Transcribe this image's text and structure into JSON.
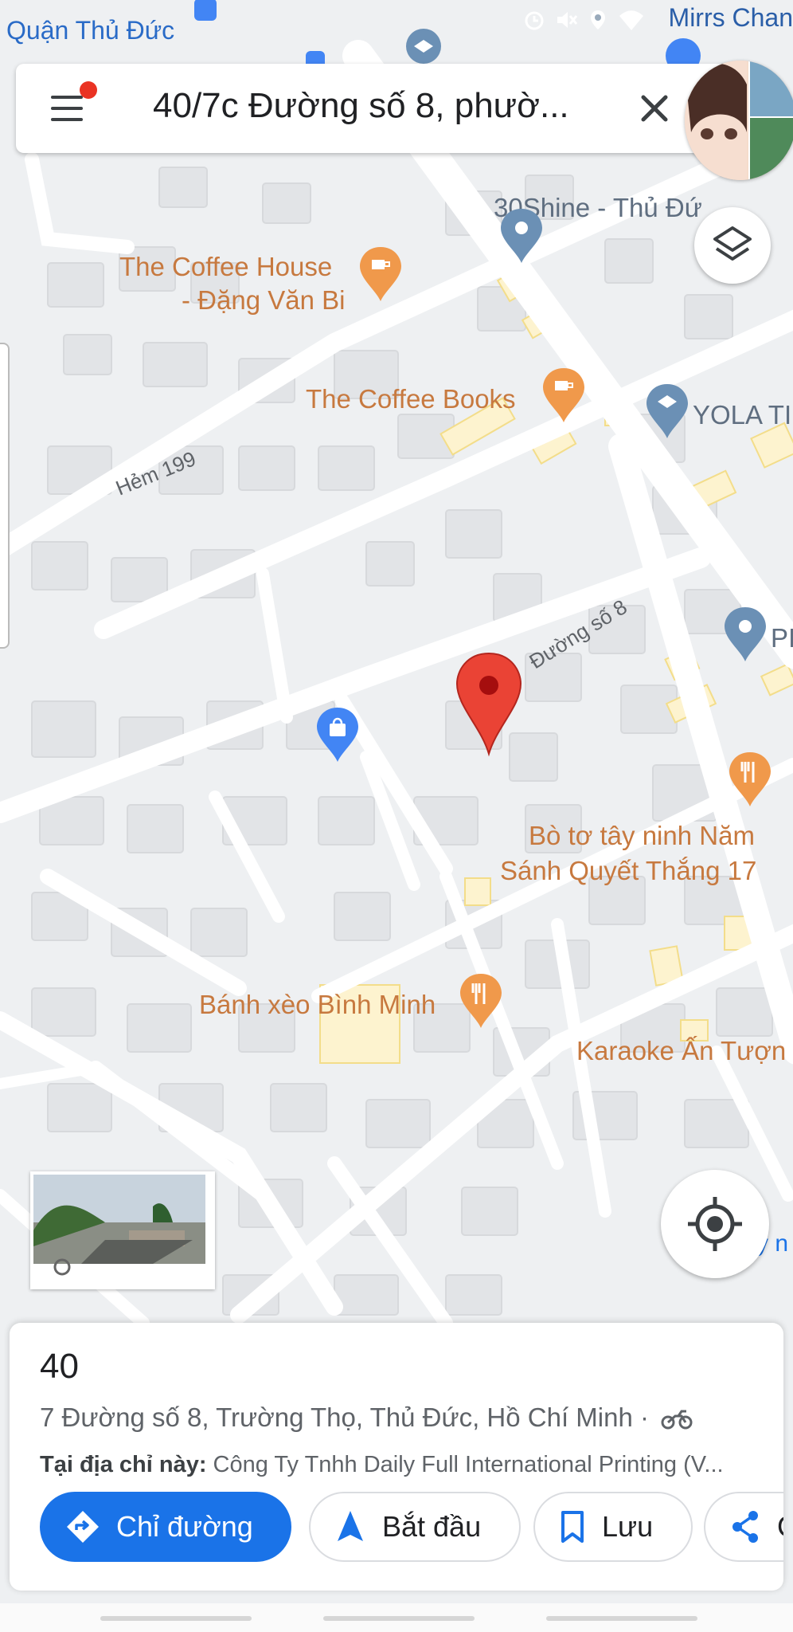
{
  "status_bar": {
    "background_text": "Quận Thủ Đức",
    "carrier": "Mirrs Chan"
  },
  "search": {
    "query": "40/7c Đường số 8, phườ..."
  },
  "map": {
    "road_labels": [
      "Hẻm 199",
      "Đường số 8"
    ],
    "pois": [
      {
        "name": "30Shine - Thủ Đứ",
        "icon": "generic-pin-icon",
        "color": "#6b90b5"
      },
      {
        "name": "The Coffee House - Đặng Văn Bi",
        "icon": "cafe-icon",
        "color": "#f0994b"
      },
      {
        "name": "The Coffee Books",
        "icon": "cafe-icon",
        "color": "#f0994b"
      },
      {
        "name": "YOLA TI",
        "icon": "school-icon",
        "color": "#6b90b5"
      },
      {
        "name": "PI",
        "icon": "generic-pin-icon",
        "color": "#6b90b5"
      },
      {
        "name": "Bò tơ tây ninh Năm Sánh Quyết Thắng 17",
        "icon": "restaurant-icon",
        "color": "#f0994b"
      },
      {
        "name": "Bánh xèo Bình Minh",
        "icon": "restaurant-icon",
        "color": "#f0994b"
      },
      {
        "name": "Karaoke Ấn Tượn",
        "icon": "none",
        "color": "#e07a3a"
      }
    ],
    "selected_pin_color": "#ea4335"
  },
  "place": {
    "title": "40",
    "address": "7 Đường số 8, Trường Thọ, Thủ Đức, Hồ Chí Minh · ",
    "at_label": "Tại địa chỉ này:",
    "at_value": " Công Ty Tnhh Daily Full International Printing (V..."
  },
  "actions": {
    "directions": "Chỉ đường",
    "start": "Bắt đầu",
    "save": "Lưu",
    "share": "C"
  },
  "colors": {
    "accent": "#1a73e8",
    "poi_orange": "#f0994b",
    "poi_blue": "#6b90b5"
  }
}
